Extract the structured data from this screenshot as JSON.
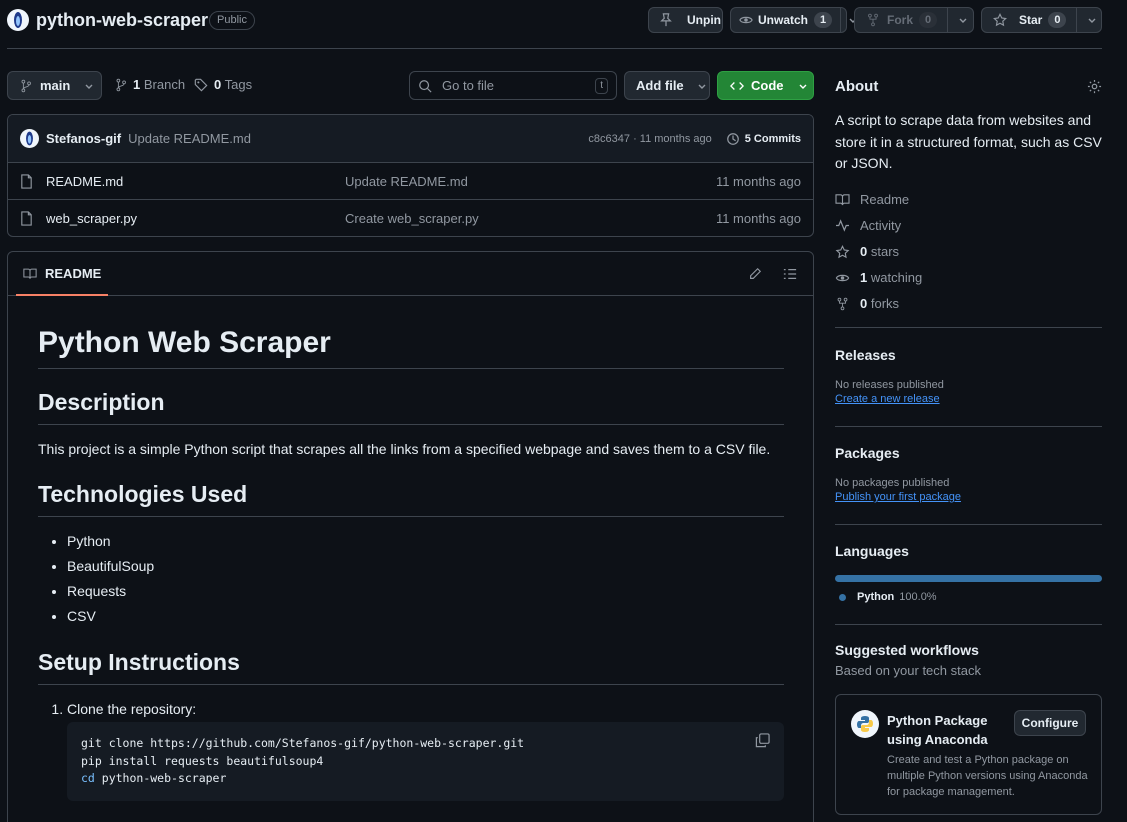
{
  "repo": {
    "name": "python-web-scraper",
    "visibility": "Public"
  },
  "header_actions": {
    "unpin": "Unpin",
    "unwatch": "Unwatch",
    "watch_count": "1",
    "fork": "Fork",
    "fork_count": "0",
    "star": "Star",
    "star_count": "0"
  },
  "toolbar": {
    "branch": "main",
    "branch_count": "1",
    "branch_label": "Branch",
    "tag_count": "0",
    "tag_label": "Tags",
    "search_placeholder": "Go to file",
    "search_key": "t",
    "add_file": "Add file",
    "code": "Code"
  },
  "commit": {
    "author": "Stefanos-gif",
    "message": "Update README.md",
    "meta": "c8c6347 · 11 months ago",
    "commits": "5 Commits"
  },
  "files": [
    {
      "name": "README.md",
      "message": "Update README.md",
      "age": "11 months ago"
    },
    {
      "name": "web_scraper.py",
      "message": "Create web_scraper.py",
      "age": "11 months ago"
    }
  ],
  "readme": {
    "tab": "README",
    "h1": "Python Web Scraper",
    "h2_description": "Description",
    "description": "This project is a simple Python script that scrapes all the links from a specified webpage and saves them to a CSV file.",
    "h2_tech": "Technologies Used",
    "tech": [
      "Python",
      "BeautifulSoup",
      "Requests",
      "CSV"
    ],
    "h2_setup": "Setup Instructions",
    "step1": "Clone the repository:",
    "code": {
      "line1": "git clone https://github.com/Stefanos-gif/python-web-scraper.git",
      "line2": "pip install requests beautifulsoup4",
      "line3_kw": "cd",
      "line3_rest": " python-web-scraper"
    }
  },
  "about": {
    "title": "About",
    "description": "A script to scrape data from websites and store it in a structured format, such as CSV or JSON.",
    "readme": "Readme",
    "activity": "Activity",
    "stars_n": "0",
    "stars": "stars",
    "watching_n": "1",
    "watching": "watching",
    "forks_n": "0",
    "forks": "forks"
  },
  "releases": {
    "title": "Releases",
    "none": "No releases published",
    "create": "Create a new release"
  },
  "packages": {
    "title": "Packages",
    "none": "No packages published",
    "publish": "Publish your first package"
  },
  "languages": {
    "title": "Languages",
    "name": "Python",
    "percent": "100.0%",
    "color": "#3572A5"
  },
  "workflows": {
    "title": "Suggested workflows",
    "subtitle": "Based on your tech stack",
    "card_title": "Python Package using Anaconda",
    "configure": "Configure",
    "card_desc": "Create and test a Python package on multiple Python versions using Anaconda for package management."
  }
}
